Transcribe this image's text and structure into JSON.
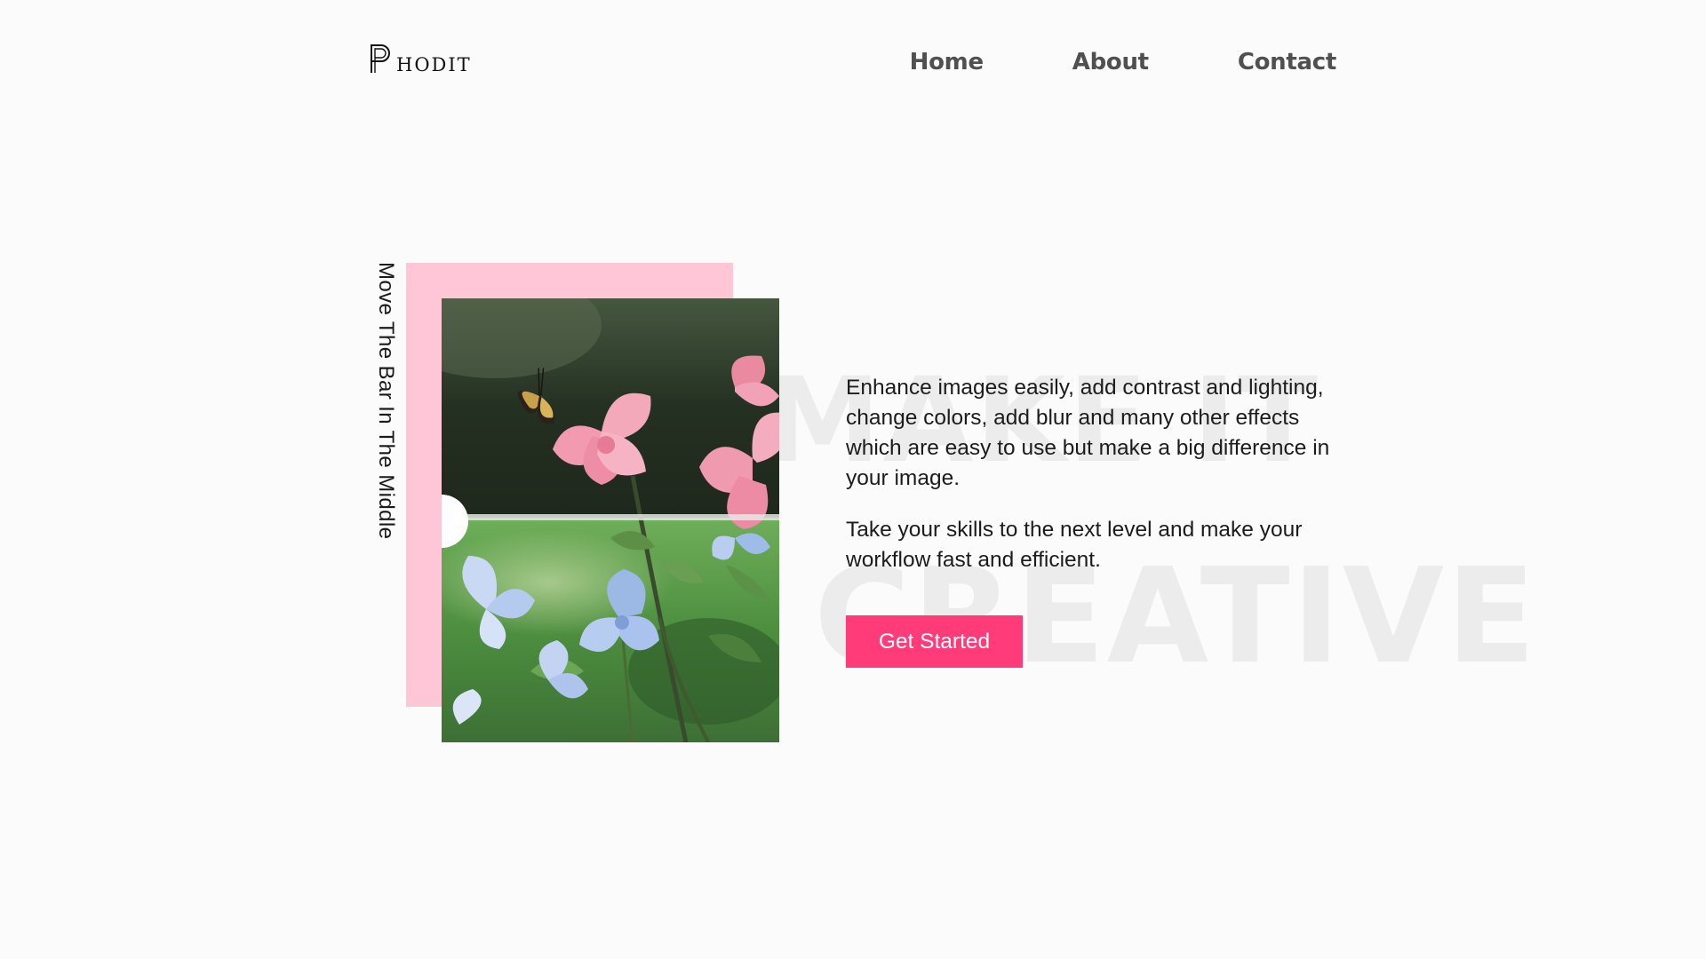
{
  "brand": {
    "logo_initial": "P",
    "logo_rest": "HODIT"
  },
  "nav": {
    "items": [
      {
        "label": "Home"
      },
      {
        "label": "About"
      },
      {
        "label": "Contact"
      }
    ]
  },
  "hero": {
    "vertical_label": "Move The Bar In The Middle",
    "watermark_line1": "MAKE IT",
    "watermark_line2": "CREATIVE",
    "paragraph_1": "Enhance images easily, add contrast and lighting, change colors, add blur and many other effects which are easy to use but make a big difference in your image.",
    "paragraph_2": "Take your skills to the next level and make your workflow fast and efficient.",
    "cta_label": "Get Started",
    "image_subject": "pink and blue flowers with butterfly"
  },
  "colors": {
    "background": "#fbfbfb",
    "accent": "#ff3b7a",
    "pink_block": "#ffc6d8",
    "nav_text": "#505050",
    "watermark": "#ececec"
  }
}
